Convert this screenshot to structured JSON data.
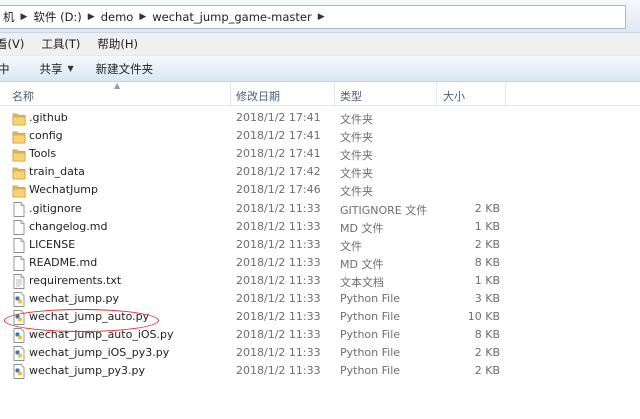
{
  "address": {
    "crumbs": [
      "机",
      "软件 (D:)",
      "demo",
      "wechat_jump_game-master"
    ]
  },
  "menu": {
    "items": [
      "看(V)",
      "工具(T)",
      "帮助(H)"
    ]
  },
  "toolbar": {
    "organize_label": "中",
    "share_label": "共享",
    "new_folder_label": "新建文件夹"
  },
  "columns": {
    "name": "名称",
    "date": "修改日期",
    "type": "类型",
    "size": "大小"
  },
  "files": [
    {
      "name": ".github",
      "date": "2018/1/2 17:41",
      "type": "文件夹",
      "size": "",
      "icon": "folder-icon"
    },
    {
      "name": "config",
      "date": "2018/1/2 17:41",
      "type": "文件夹",
      "size": "",
      "icon": "folder-icon"
    },
    {
      "name": "Tools",
      "date": "2018/1/2 17:41",
      "type": "文件夹",
      "size": "",
      "icon": "folder-icon"
    },
    {
      "name": "train_data",
      "date": "2018/1/2 17:42",
      "type": "文件夹",
      "size": "",
      "icon": "folder-icon"
    },
    {
      "name": "WechatJump",
      "date": "2018/1/2 17:46",
      "type": "文件夹",
      "size": "",
      "icon": "folder-icon"
    },
    {
      "name": ".gitignore",
      "date": "2018/1/2 11:33",
      "type": "GITIGNORE 文件",
      "size": "2 KB",
      "icon": "file-icon"
    },
    {
      "name": "changelog.md",
      "date": "2018/1/2 11:33",
      "type": "MD 文件",
      "size": "1 KB",
      "icon": "file-icon"
    },
    {
      "name": "LICENSE",
      "date": "2018/1/2 11:33",
      "type": "文件",
      "size": "2 KB",
      "icon": "file-icon"
    },
    {
      "name": "README.md",
      "date": "2018/1/2 11:33",
      "type": "MD 文件",
      "size": "8 KB",
      "icon": "file-icon"
    },
    {
      "name": "requirements.txt",
      "date": "2018/1/2 11:33",
      "type": "文本文档",
      "size": "1 KB",
      "icon": "text-file-icon"
    },
    {
      "name": "wechat_jump.py",
      "date": "2018/1/2 11:33",
      "type": "Python File",
      "size": "3 KB",
      "icon": "python-file-icon"
    },
    {
      "name": "wechat_jump_auto.py",
      "date": "2018/1/2 11:33",
      "type": "Python File",
      "size": "10 KB",
      "icon": "python-file-icon"
    },
    {
      "name": "wechat_jump_auto_iOS.py",
      "date": "2018/1/2 11:33",
      "type": "Python File",
      "size": "8 KB",
      "icon": "python-file-icon"
    },
    {
      "name": "wechat_jump_iOS_py3.py",
      "date": "2018/1/2 11:33",
      "type": "Python File",
      "size": "2 KB",
      "icon": "python-file-icon"
    },
    {
      "name": "wechat_jump_py3.py",
      "date": "2018/1/2 11:33",
      "type": "Python File",
      "size": "2 KB",
      "icon": "python-file-icon"
    }
  ],
  "annotation_color": "#d9262b"
}
